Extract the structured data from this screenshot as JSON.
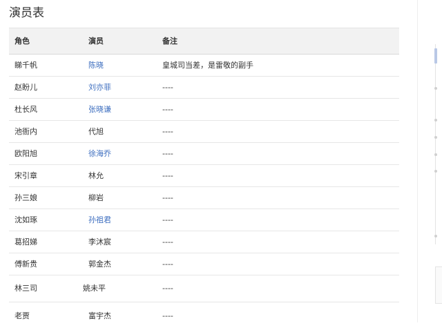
{
  "page": {
    "title": "演员表"
  },
  "table": {
    "headers": [
      "角色",
      "演员",
      "备注"
    ],
    "rows": [
      {
        "role": "睇千帆",
        "actor": "陈晓",
        "actor_link": true,
        "note": "皇城司当差，是雷敬的副手"
      },
      {
        "role": "赵盼儿",
        "actor": "刘亦菲",
        "actor_link": true,
        "note": "----"
      },
      {
        "role": "杜长风",
        "actor": "张晓谦",
        "actor_link": true,
        "note": "----"
      },
      {
        "role": "池衙内",
        "actor": "代旭",
        "actor_link": false,
        "note": "----"
      },
      {
        "role": "欧阳旭",
        "actor": "徐海乔",
        "actor_link": true,
        "note": "----"
      },
      {
        "role": "宋引章",
        "actor": "林允",
        "actor_link": false,
        "note": "----"
      },
      {
        "role": "孙三娘",
        "actor": "柳岩",
        "actor_link": false,
        "note": "----"
      },
      {
        "role": "沈如琢",
        "actor": "孙祖君",
        "actor_link": true,
        "note": "----"
      },
      {
        "role": "葛招娣",
        "actor": "李沐宸",
        "actor_link": false,
        "note": "----"
      },
      {
        "role": "傅新贵",
        "actor": "郭金杰",
        "actor_link": false,
        "note": "----"
      },
      {
        "role": "林三司",
        "actor": "姚未平",
        "actor_link": false,
        "note": "----"
      },
      {
        "role": "老贾",
        "actor": "富宇杰",
        "actor_link": false,
        "note": "----"
      }
    ]
  },
  "colors": {
    "link": "#3d6ebf",
    "header_bg": "#f2f2f2",
    "border": "#e6e6e6"
  }
}
